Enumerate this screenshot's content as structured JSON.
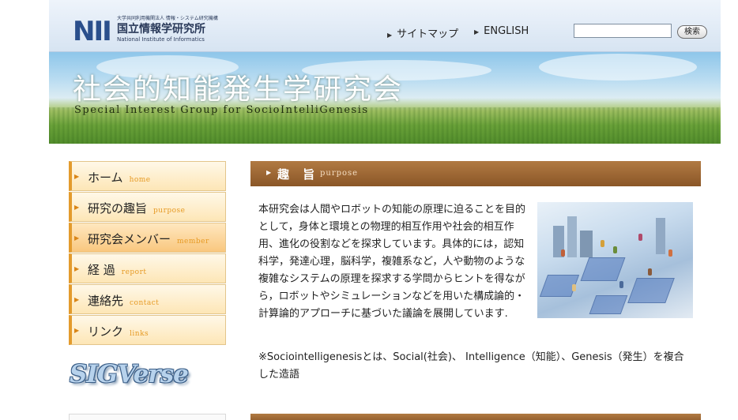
{
  "header": {
    "logo_mark": "NII",
    "logo_org_small": "大学共同利用機関法人 情報・システム研究機構",
    "logo_org_name": "国立情報学研究所",
    "logo_org_en": "National Institute of Informatics",
    "links": [
      "サイトマップ",
      "ENGLISH"
    ],
    "search_value": "",
    "search_button": "検索"
  },
  "banner": {
    "title": "社会的知能発生学研究会",
    "subtitle": "Special Interest Group for SocioIntelliGenesis"
  },
  "nav": {
    "items": [
      {
        "jp": "ホーム",
        "en": "home",
        "active": false
      },
      {
        "jp": "研究の趣旨",
        "en": "purpose",
        "active": false
      },
      {
        "jp": "研究会メンバー",
        "en": "member",
        "active": true
      },
      {
        "jp": "経 過",
        "en": "report",
        "active": false
      },
      {
        "jp": "連絡先",
        "en": "contact",
        "active": false
      },
      {
        "jp": "リンク",
        "en": "links",
        "active": false
      }
    ],
    "banner_logo": "SIGVerse"
  },
  "section": {
    "title_jp": "趣 旨",
    "title_en": "purpose",
    "body": "本研究会は人間やロボットの知能の原理に迫ることを目的として，身体と環境との物理的相互作用や社会的相互作用、進化の役割などを探求しています。具体的には，認知科学，発達心理，脳科学，複雑系など，人や動物のような複雑なシステムの原理を探求する学問からヒントを得ながら，ロボットやシミュレーションなどを用いた構成論的・計算論的アプローチに基づいた議論を展開しています.",
    "note": "※Sociointelligenesisとは、Social(社会)、 Intelligence（知能）、Genesis（発生）を複合した造語"
  },
  "colors": {
    "accent_orange": "#e39b2d",
    "section_brown": "#9a6532",
    "header_blue": "#2a4f8c"
  }
}
